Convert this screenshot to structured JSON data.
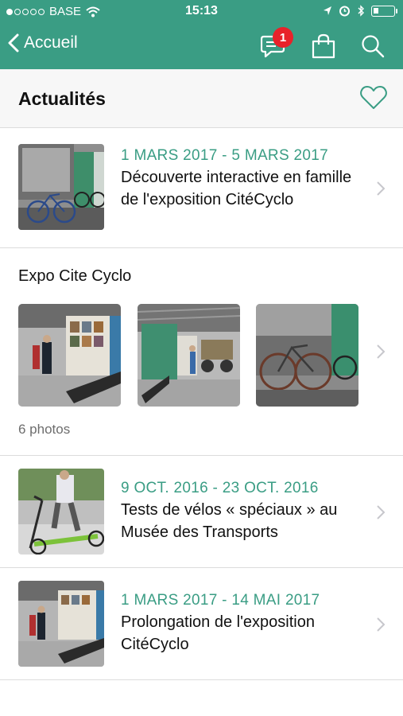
{
  "status_bar": {
    "carrier": "BASE",
    "time": "15:13",
    "signal_bars_filled": 1,
    "battery_level": 0.25
  },
  "nav": {
    "back_label": "Accueil",
    "messages_badge": "1",
    "icons": [
      "messages-icon",
      "shopping-bag-icon",
      "search-icon"
    ]
  },
  "section": {
    "title": "Actualités"
  },
  "news": [
    {
      "date": "1 MARS 2017 - 5 MARS 2017",
      "title": "Découverte interactive en famille de l'exposition CitéCyclo"
    },
    {
      "date": "9 OCT. 2016 - 23 OCT. 2016",
      "title": "Tests de vélos « spéciaux » au Musée des Transports"
    },
    {
      "date": "1 MARS 2017 - 14 MAI 2017",
      "title": "Prolongation de l'exposition CitéCyclo"
    }
  ],
  "gallery": {
    "title": "Expo Cite Cyclo",
    "count_label": "6 photos"
  },
  "colors": {
    "brand": "#3a9d84",
    "badge": "#e8222a",
    "date_text": "#3a9d84",
    "separator": "#dcdcdc"
  }
}
